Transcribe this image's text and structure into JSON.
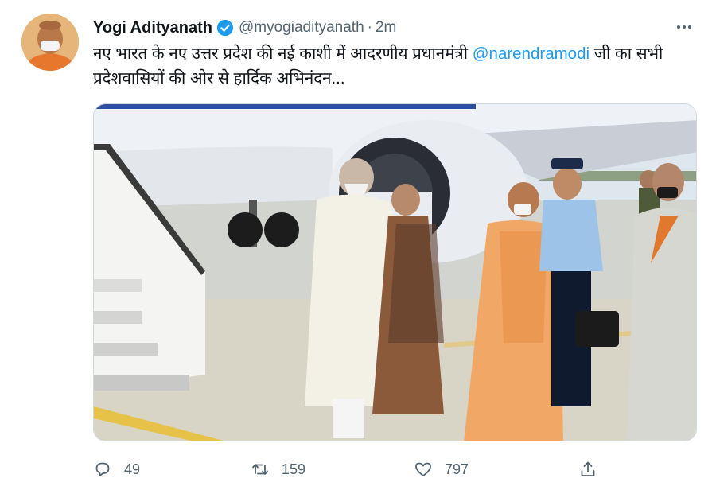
{
  "tweet": {
    "author_name": "Yogi Adityanath",
    "handle": "@myogiadityanath",
    "separator": "·",
    "time": "2m",
    "text_part1": "नए भारत के नए उत्तर प्रदेश की नई काशी में आदरणीय प्रधानमंत्री ",
    "mention": "@narendramodi",
    "text_part2": " जी का सभी प्रदेशवासियों की ओर से हार्दिक अभिनंदन..."
  },
  "actions": {
    "reply_count": "49",
    "retweet_count": "159",
    "like_count": "797"
  },
  "icons": {
    "verified": "verified-badge-icon",
    "more": "more-options-icon",
    "reply": "reply-icon",
    "retweet": "retweet-icon",
    "like": "heart-icon",
    "share": "share-icon"
  },
  "colors": {
    "text": "#0f1419",
    "secondary": "#536471",
    "accent": "#1d9bf0"
  }
}
